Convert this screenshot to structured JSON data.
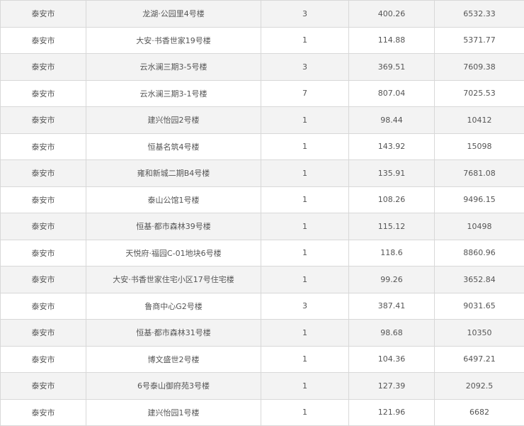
{
  "table": {
    "rows": [
      [
        "泰安市",
        "龙湖·公园里4号楼",
        "3",
        "400.26",
        "6532.33"
      ],
      [
        "泰安市",
        "大安·书香世家19号楼",
        "1",
        "114.88",
        "5371.77"
      ],
      [
        "泰安市",
        "云水澜三期3-5号楼",
        "3",
        "369.51",
        "7609.38"
      ],
      [
        "泰安市",
        "云水澜三期3-1号楼",
        "7",
        "807.04",
        "7025.53"
      ],
      [
        "泰安市",
        "建兴怡园2号楼",
        "1",
        "98.44",
        "10412"
      ],
      [
        "泰安市",
        "恒基名筑4号楼",
        "1",
        "143.92",
        "15098"
      ],
      [
        "泰安市",
        "雍和新城二期B4号楼",
        "1",
        "135.91",
        "7681.08"
      ],
      [
        "泰安市",
        "泰山公馆1号楼",
        "1",
        "108.26",
        "9496.15"
      ],
      [
        "泰安市",
        "恒基·都市森林39号楼",
        "1",
        "115.12",
        "10498"
      ],
      [
        "泰安市",
        "天悦府·福园C-01地块6号楼",
        "1",
        "118.6",
        "8860.96"
      ],
      [
        "泰安市",
        "大安·书香世家住宅小区17号住宅楼",
        "1",
        "99.26",
        "3652.84"
      ],
      [
        "泰安市",
        "鲁商中心G2号楼",
        "3",
        "387.41",
        "9031.65"
      ],
      [
        "泰安市",
        "恒基·都市森林31号楼",
        "1",
        "98.68",
        "10350"
      ],
      [
        "泰安市",
        "博文盛世2号楼",
        "1",
        "104.36",
        "6497.21"
      ],
      [
        "泰安市",
        "6号泰山御府苑3号楼",
        "1",
        "127.39",
        "2092.5"
      ],
      [
        "泰安市",
        "建兴怡园1号楼",
        "1",
        "121.96",
        "6682"
      ]
    ]
  }
}
